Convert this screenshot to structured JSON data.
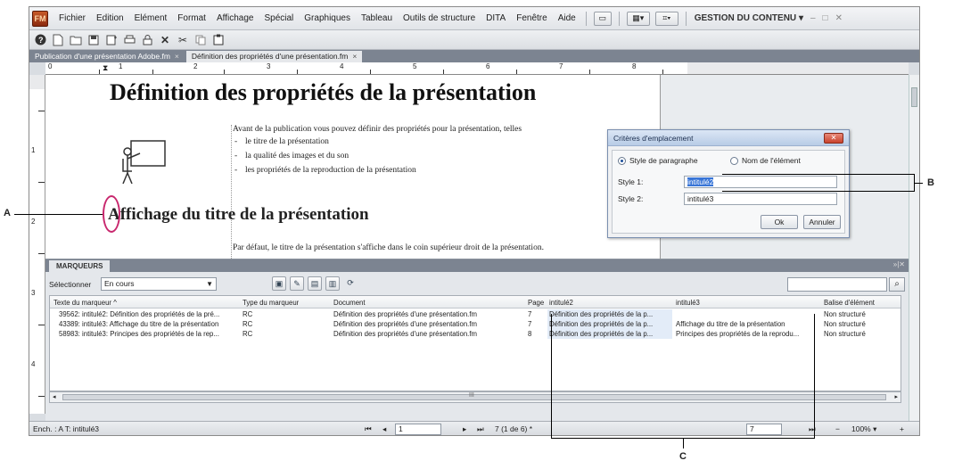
{
  "app": {
    "logo": "FM",
    "menu": [
      "Fichier",
      "Edition",
      "Elément",
      "Format",
      "Affichage",
      "Spécial",
      "Graphiques",
      "Tableau",
      "Outils de structure",
      "DITA",
      "Fenêtre",
      "Aide"
    ],
    "workspace": "GESTION DU CONTENU",
    "window_controls": [
      "–",
      "□",
      "✕"
    ]
  },
  "toolbar": {
    "icons": [
      "help-icon",
      "new-document-icon",
      "open-folder-icon",
      "save-icon",
      "save-as-icon",
      "print-icon",
      "lock-icon",
      "delete-icon",
      "cut-icon",
      "copy-icon",
      "paste-icon"
    ]
  },
  "tabs": [
    {
      "label": "Publication d'une présentation Adobe.fm",
      "close": "×"
    },
    {
      "label": "Définition des propriétés d'une présentation.fm",
      "close": "×"
    }
  ],
  "ruler": {
    "h_numbers": [
      "0",
      "1",
      "2",
      "3",
      "4",
      "5",
      "6",
      "7",
      "8"
    ],
    "v_numbers": [
      "1",
      "2",
      "3",
      "4"
    ]
  },
  "document": {
    "title": "Définition des propriétés de la présentation",
    "intro": "Avant de la publication vous pouvez définir des propriétés pour la présentation, telles",
    "bullets": [
      "le titre de la présentation",
      "la qualité des images et du son",
      "les propriétés de la reproduction de la présentation"
    ],
    "heading2": "Affichage du titre de la présentation",
    "para": "Par défaut, le titre de la présentation s'affiche dans le coin supérieur droit de la présentation."
  },
  "dialog": {
    "title": "Critères d'emplacement",
    "radio_paragraph": "Style de paragraphe",
    "radio_element": "Nom de l'élément",
    "style1_label": "Style 1:",
    "style1_value": "intitulé2",
    "style2_label": "Style 2:",
    "style2_value": "intitulé3",
    "ok": "Ok",
    "cancel": "Annuler",
    "close": "✕"
  },
  "panel": {
    "tab": "MARQUEURS",
    "controls": "»|✕",
    "select_label": "Sélectionner",
    "filter_value": "En cours",
    "search_placeholder": "",
    "columns": [
      "Texte du marqueur",
      "Type du marqueur",
      "Document",
      "Page",
      "intitulé2",
      "intitulé3",
      "Balise d'élément"
    ],
    "rows": [
      [
        "39562: intitulé2: Définition des propriétés de la pré...",
        "RC",
        "Définition des propriétés d'une présentation.fm",
        "7",
        "Définition des propriétés de la p...",
        "",
        "Non structuré"
      ],
      [
        "43389: intitulé3: Affichage du titre de la présentation",
        "RC",
        "Définition des propriétés d'une présentation.fm",
        "7",
        "Définition des propriétés de la p...",
        "Affichage du titre de la présentation",
        "Non structuré"
      ],
      [
        "58983: intitulé3: Principes des propriétés de la rep...",
        "RC",
        "Définition des propriétés d'une présentation.fm",
        "8",
        "Définition des propriétés de la p...",
        "Principes des propriétés de la reprodu...",
        "Non structuré"
      ]
    ],
    "hscroll_grip": "III"
  },
  "status": {
    "location": "Ench. : A  T: intitulé3",
    "page_value": "1",
    "page_info": "7 (1 de 6) *",
    "goto_value": "7",
    "zoom": "100%"
  },
  "callouts": {
    "a": "A",
    "b": "B",
    "c": "C"
  },
  "colors": {
    "accent": "#3875d7",
    "callout_ellipse": "#c8286e",
    "tabbar": "#7c8491"
  }
}
